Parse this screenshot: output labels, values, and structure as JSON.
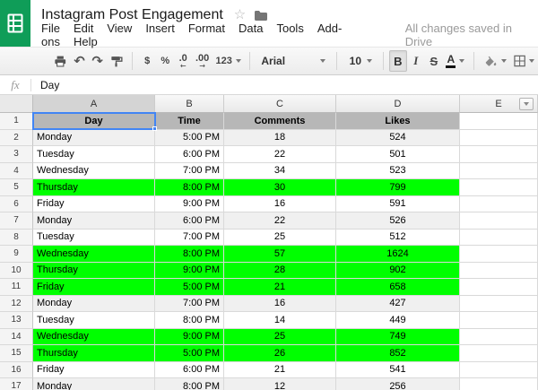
{
  "header": {
    "title": "Instagram Post Engagement",
    "menu_items": [
      "File",
      "Edit",
      "View",
      "Insert",
      "Format",
      "Data",
      "Tools",
      "Add-ons",
      "Help"
    ],
    "status": "All changes saved in Drive"
  },
  "icons": {
    "undo": "↶",
    "redo": "↷",
    "star": "☆"
  },
  "toolbar": {
    "currency_label": "$",
    "percent_label": "%",
    "decrease_decimal_label": ".0",
    "decrease_decimal_arrow": "←",
    "increase_decimal_label": ".00",
    "increase_decimal_arrow": "→",
    "number_format_label": "123",
    "font_name": "Arial",
    "font_size": "10",
    "bold_label": "B",
    "italic_label": "I",
    "strikethrough_label": "S",
    "text_color_label": "A"
  },
  "formula_bar": {
    "fx_label": "fx",
    "value": "Day"
  },
  "grid": {
    "column_letters": [
      "A",
      "B",
      "C",
      "D",
      "E"
    ],
    "header_row": [
      "Day",
      "Time",
      "Comments",
      "Likes"
    ],
    "selected_cell": "A1",
    "rows": [
      {
        "n": 2,
        "day": "Monday",
        "time": "5:00 PM",
        "comments": "18",
        "likes": "524",
        "highlight": "gray"
      },
      {
        "n": 3,
        "day": "Tuesday",
        "time": "6:00 PM",
        "comments": "22",
        "likes": "501",
        "highlight": "none"
      },
      {
        "n": 4,
        "day": "Wednesday",
        "time": "7:00 PM",
        "comments": "34",
        "likes": "523",
        "highlight": "none"
      },
      {
        "n": 5,
        "day": "Thursday",
        "time": "8:00 PM",
        "comments": "30",
        "likes": "799",
        "highlight": "green"
      },
      {
        "n": 6,
        "day": "Friday",
        "time": "9:00 PM",
        "comments": "16",
        "likes": "591",
        "highlight": "none"
      },
      {
        "n": 7,
        "day": "Monday",
        "time": "6:00 PM",
        "comments": "22",
        "likes": "526",
        "highlight": "gray"
      },
      {
        "n": 8,
        "day": "Tuesday",
        "time": "7:00 PM",
        "comments": "25",
        "likes": "512",
        "highlight": "none"
      },
      {
        "n": 9,
        "day": "Wednesday",
        "time": "8:00 PM",
        "comments": "57",
        "likes": "1624",
        "highlight": "green"
      },
      {
        "n": 10,
        "day": "Thursday",
        "time": "9:00 PM",
        "comments": "28",
        "likes": "902",
        "highlight": "green"
      },
      {
        "n": 11,
        "day": "Friday",
        "time": "5:00 PM",
        "comments": "21",
        "likes": "658",
        "highlight": "green"
      },
      {
        "n": 12,
        "day": "Monday",
        "time": "7:00 PM",
        "comments": "16",
        "likes": "427",
        "highlight": "gray"
      },
      {
        "n": 13,
        "day": "Tuesday",
        "time": "8:00 PM",
        "comments": "14",
        "likes": "449",
        "highlight": "none"
      },
      {
        "n": 14,
        "day": "Wednesday",
        "time": "9:00 PM",
        "comments": "25",
        "likes": "749",
        "highlight": "green"
      },
      {
        "n": 15,
        "day": "Thursday",
        "time": "5:00 PM",
        "comments": "26",
        "likes": "852",
        "highlight": "green"
      },
      {
        "n": 16,
        "day": "Friday",
        "time": "6:00 PM",
        "comments": "21",
        "likes": "541",
        "highlight": "none"
      },
      {
        "n": 17,
        "day": "Monday",
        "time": "8:00 PM",
        "comments": "12",
        "likes": "256",
        "highlight": "gray"
      }
    ]
  },
  "colors": {
    "brand_green": "#0f9d58",
    "highlight_green": "#00ff00",
    "header_row_gray": "#b7b7b7",
    "monday_row_gray": "#f0f0f0",
    "selection_blue": "#4285f4"
  }
}
